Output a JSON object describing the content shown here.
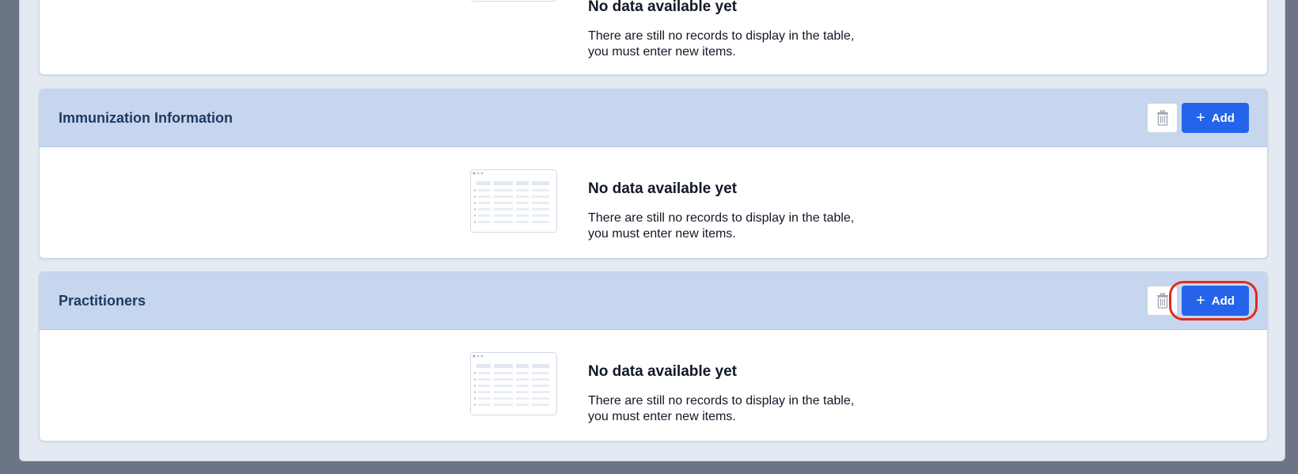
{
  "sections": [
    {
      "title": "",
      "empty_title": "No data available yet",
      "empty_desc": "There are still no records to display in the table, you must enter new items."
    },
    {
      "title": "Immunization Information",
      "add_label": "Add",
      "empty_title": "No data available yet",
      "empty_desc": "There are still no records to display in the table, you must enter new items."
    },
    {
      "title": "Practitioners",
      "add_label": "Add",
      "empty_title": "No data available yet",
      "empty_desc": "There are still no records to display in the table, you must enter new items."
    }
  ],
  "colors": {
    "header_bg": "#c5d6ee",
    "add_button": "#2563eb",
    "highlight": "#e32a1a"
  },
  "icons": {
    "delete": "trash-icon",
    "add": "plus-icon",
    "empty": "empty-table-icon"
  }
}
